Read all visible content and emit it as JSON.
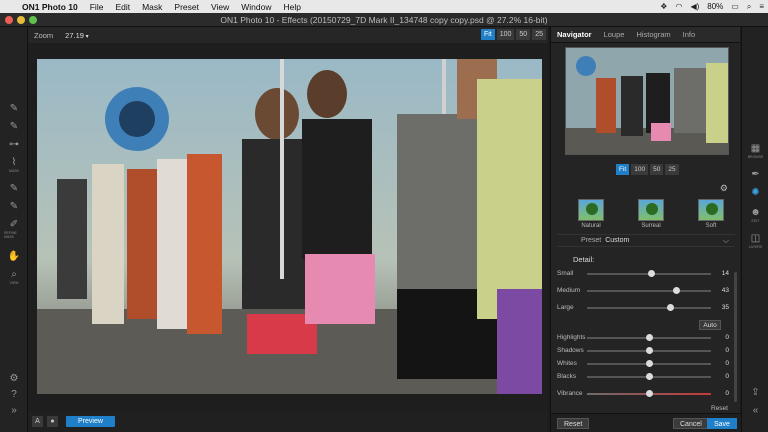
{
  "menubar": {
    "app": "ON1 Photo 10",
    "items": [
      "File",
      "Edit",
      "Mask",
      "Preset",
      "View",
      "Window",
      "Help"
    ],
    "battery": "80%",
    "status_icons": [
      "dropbox-icon",
      "wifi-icon",
      "volume-icon",
      "battery-icon"
    ]
  },
  "window": {
    "title": "ON1 Photo 10 - Effects (20150729_7D Mark II_134748 copy copy.psd @ 27.2% 16-bit)"
  },
  "toolbar": {
    "zoom_label": "Zoom",
    "zoom_value": "27.19",
    "zoom_buttons": [
      "Fit",
      "100",
      "50",
      "25"
    ],
    "zoom_active": "Fit"
  },
  "tools": [
    {
      "icon": "brush-icon",
      "label": ""
    },
    {
      "icon": "brush-plus-icon",
      "label": ""
    },
    {
      "icon": "gradient-icon",
      "label": ""
    },
    {
      "icon": "mask-icon",
      "label": "MASK"
    },
    {
      "icon": "brush-icon",
      "label": ""
    },
    {
      "icon": "brush-plus-icon",
      "label": ""
    },
    {
      "icon": "refine-mask-icon",
      "label": "REFINE MASK"
    },
    {
      "icon": "hand-icon",
      "label": ""
    },
    {
      "icon": "zoom-icon",
      "label": "VIEW"
    }
  ],
  "bottom": {
    "preview_label": "Preview",
    "compare_icon": "A"
  },
  "panel": {
    "tabs": [
      "Navigator",
      "Loupe",
      "Histogram",
      "Info"
    ],
    "active_tab": "Navigator",
    "nav_zoom_buttons": [
      "Fit",
      "100",
      "50",
      "25"
    ],
    "presets": [
      "Natural",
      "Surreal",
      "Soft"
    ],
    "preset_label": "Preset",
    "preset_value": "Custom",
    "detail_title": "Detail:",
    "detail_sliders": [
      {
        "label": "Small",
        "value": 14,
        "pct": 0.52
      },
      {
        "label": "Medium",
        "value": 43,
        "pct": 0.72
      },
      {
        "label": "Large",
        "value": 35,
        "pct": 0.67
      }
    ],
    "auto_label": "Auto",
    "tone_sliders": [
      {
        "label": "Highlights",
        "value": 0,
        "pct": 0.5
      },
      {
        "label": "Shadows",
        "value": 0,
        "pct": 0.5
      },
      {
        "label": "Whites",
        "value": 0,
        "pct": 0.5
      },
      {
        "label": "Blacks",
        "value": 0,
        "pct": 0.5
      },
      {
        "label": "Vibrance",
        "value": 0,
        "pct": 0.5
      }
    ],
    "reset_small": "Reset",
    "reset_label": "Reset",
    "cancel_label": "Cancel",
    "save_label": "Save"
  },
  "modules": [
    {
      "icon": "browse-icon",
      "label": "BROWSE"
    },
    {
      "icon": "develop-icon",
      "label": ""
    },
    {
      "icon": "effects-icon",
      "label": ""
    },
    {
      "icon": "portrait-icon",
      "label": "EDIT"
    },
    {
      "icon": "layers-icon",
      "label": "LAYERS"
    }
  ],
  "colors": {
    "accent": "#1f7fc8",
    "active_icon": "#3aa8e8",
    "vibrance_track": "#c63a3a"
  }
}
